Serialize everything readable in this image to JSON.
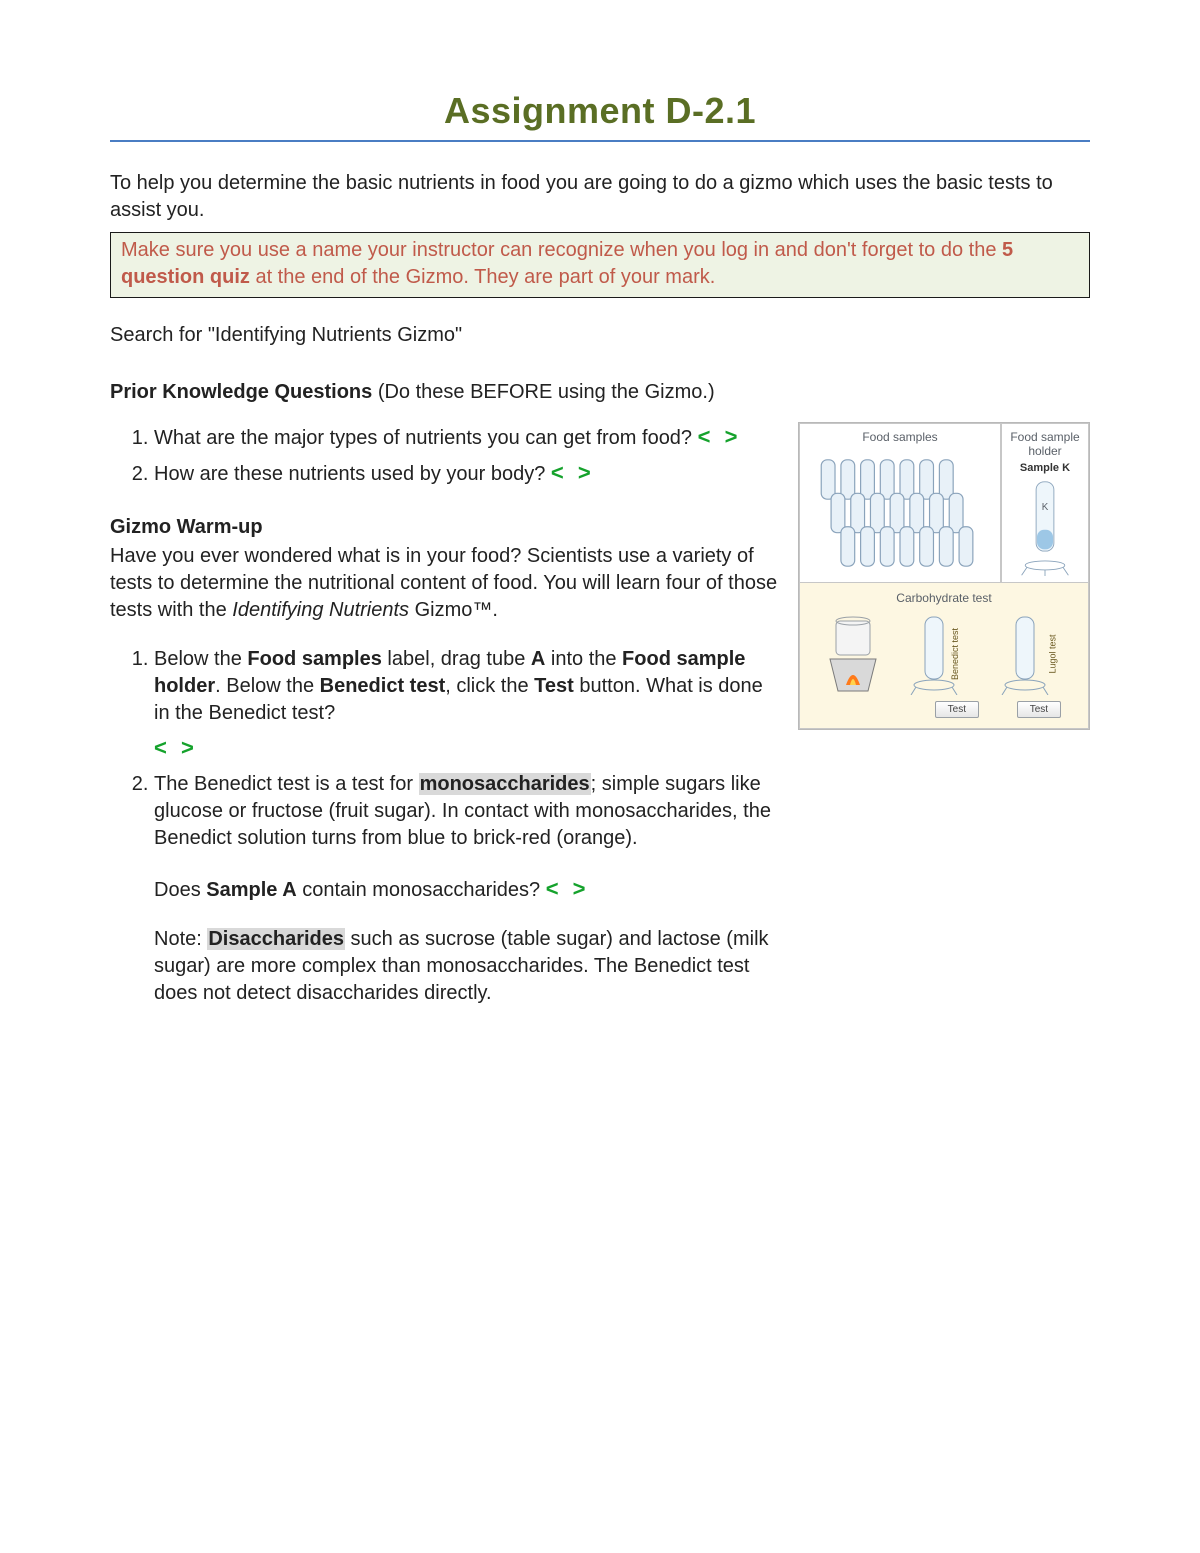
{
  "title": "Assignment D-2.1",
  "intro": "To help you determine the basic nutrients in food you are going to do a gizmo which uses the basic tests to assist you.",
  "notice_a": "Make sure you use a name your instructor can recognize when you log in and don't forget to do the ",
  "notice_bold": "5 question quiz",
  "notice_b": " at the end of the Gizmo. They are part of your mark.",
  "search_line": "Search for \"Identifying Nutrients Gizmo\"",
  "pk_head": "Prior Knowledge Questions",
  "pk_sub": " (Do these BEFORE using the Gizmo.)",
  "pk": [
    "What are the major types of nutrients you can get from food?",
    "How are these nutrients used by your body?"
  ],
  "arrow_glyph": "<  >",
  "warmup": {
    "head": "Gizmo Warm-up",
    "text_a": "Have you ever wondered what is in your food? Scientists use a variety of tests to determine the nutritional content of food. You will learn four of those tests with the ",
    "text_ital": "Identifying Nutrients",
    "text_b": " Gizmo™.",
    "q1_a": "Below the ",
    "q1_b": "Food samples",
    "q1_c": " label, drag tube ",
    "q1_d": "A",
    "q1_e": " into the ",
    "q1_f": "Food sample holder",
    "q1_g": ". Below the ",
    "q1_h": "Benedict test",
    "q1_i": ", click the ",
    "q1_j": "Test",
    "q1_k": " button. What is done in the Benedict test?",
    "q2_a": "The Benedict test is a test for ",
    "q2_hl": "monosaccharides",
    "q2_b": "; simple sugars like glucose or fructose (fruit sugar). In contact with monosaccharides, the Benedict solution turns from blue to brick-red (orange).",
    "followup_a": "Does ",
    "followup_b": "Sample A",
    "followup_c": " contain monosaccharides?",
    "note_a": "Note: ",
    "note_hl": "Disaccharides",
    "note_b": " such as sucrose (table sugar) and lactose (milk sugar) are more complex than monosaccharides. The Benedict test does not detect disaccharides directly."
  },
  "diagram": {
    "food_samples_label": "Food samples",
    "holder_label": "Food sample holder",
    "holder_sample": "Sample K",
    "tube_letter": "K",
    "carb_label": "Carbohydrate test",
    "benedict_label": "Benedict test",
    "lugol_label": "Lugol test",
    "test_button": "Test"
  }
}
